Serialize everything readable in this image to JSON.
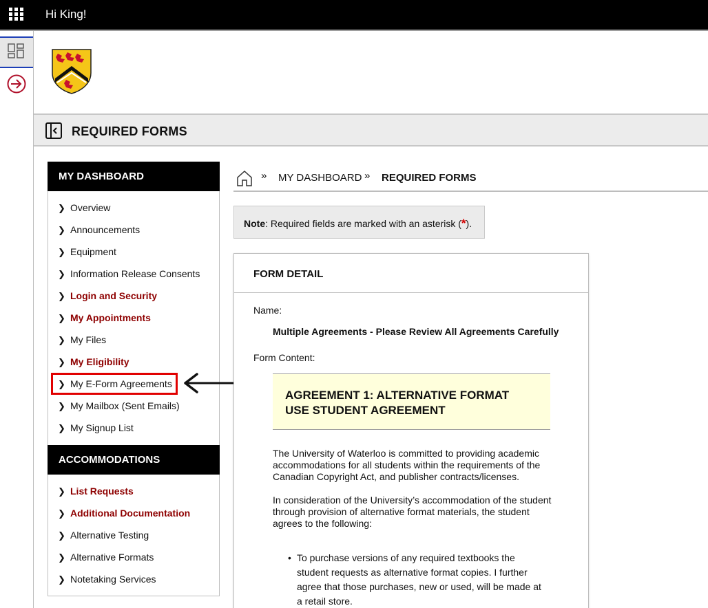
{
  "topbar": {
    "greeting": "Hi King!"
  },
  "page": {
    "title": "REQUIRED FORMS"
  },
  "sidebar": {
    "sections": [
      {
        "title": "MY DASHBOARD",
        "items": [
          {
            "label": "Overview",
            "emphasis": false
          },
          {
            "label": "Announcements",
            "emphasis": false
          },
          {
            "label": "Equipment",
            "emphasis": false
          },
          {
            "label": "Information Release Consents",
            "emphasis": false
          },
          {
            "label": "Login and Security",
            "emphasis": true
          },
          {
            "label": "My Appointments",
            "emphasis": true
          },
          {
            "label": "My Files",
            "emphasis": false
          },
          {
            "label": "My Eligibility",
            "emphasis": true
          },
          {
            "label": "My E-Form Agreements",
            "emphasis": false
          },
          {
            "label": "My Mailbox (Sent Emails)",
            "emphasis": false
          },
          {
            "label": "My Signup List",
            "emphasis": false
          }
        ]
      },
      {
        "title": "ACCOMMODATIONS",
        "items": [
          {
            "label": "List Requests",
            "emphasis": true
          },
          {
            "label": "Additional Documentation",
            "emphasis": true
          },
          {
            "label": "Alternative Testing",
            "emphasis": false
          },
          {
            "label": "Alternative Formats",
            "emphasis": false
          },
          {
            "label": "Notetaking Services",
            "emphasis": false
          }
        ]
      }
    ]
  },
  "breadcrumb": {
    "items": [
      "MY DASHBOARD",
      "REQUIRED FORMS"
    ],
    "separator": "»"
  },
  "note": {
    "bold": "Note",
    "text": ": Required fields are marked with an asterisk (",
    "asterisk": "*",
    "end": ")."
  },
  "form": {
    "heading": "FORM DETAIL",
    "name_label": "Name:",
    "name_value": "Multiple Agreements - Please Review All Agreements Carefully",
    "content_label": "Form Content:",
    "agreement_title": "AGREEMENT 1: ALTERNATIVE FORMAT USE STUDENT AGREEMENT",
    "para1": "The University of Waterloo is committed to providing academic accommodations for all students within the requirements of the Canadian Copyright Act, and publisher contracts/licenses.",
    "para2": "In consideration of the University’s accommodation of the student through provision of alternative format materials, the student agrees to the following:",
    "bullet1": "To purchase versions of any required textbooks the student requests as alternative format copies. I further agree that those purchases, new or used, will be made at a retail store."
  },
  "colors": {
    "accent_red": "#8e0000",
    "highlight": "#e10000",
    "nav_blue": "#1d3fb7",
    "agreement_bg": "#ffffdc"
  }
}
